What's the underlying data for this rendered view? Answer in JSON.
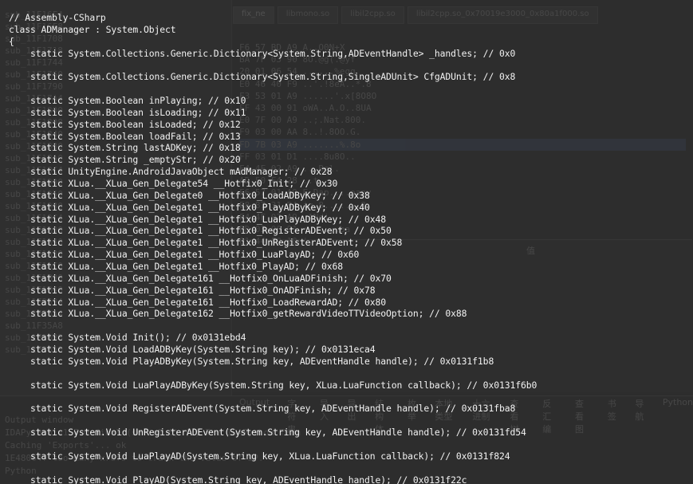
{
  "background": {
    "left_rows": [
      "sub_11F16F4",
      "sub_11F16F8",
      "sub_11F1708",
      "sub_11F1718",
      "sub_11F1744",
      "sub_11F1760",
      "sub_11F1790",
      "sub_11F17A4",
      "sub_11F1800",
      "sub_11F1808",
      "sub_11F1840",
      "sub_11F1880",
      "sub_11F18A0",
      "sub_11F18C4",
      "sub_11F1900",
      "sub_11F1950",
      "sub_11F1980",
      "sub_11F19C4",
      "sub_11F1A00",
      "sub_11F1A40",
      "sub_11F1A80",
      "sub_11F1AC0",
      "sub_11F1B00",
      "sub_11F1B40",
      "sub_11F3594",
      "sub_11F35A4",
      "sub_11F35A8",
      "sub_11F35B8",
      "sub_11F36A0"
    ],
    "tabs": [
      "fix_ne",
      "libmono.so",
      "libil2cpp.so",
      "libil2cpp.so_0x70019e3000_0x80a1f000.so"
    ],
    "hex_rows": [
      "F6 57 BD A9   A..O0N+X",
      "BA 7F 03 90   8O.@g(.@yf",
      "20 01 06 54   ......%egg",
      "E0 46 40 F9   ..'.!8eA..*.8",
      "F3 53 01 A9   ......'.x[8O8O",
      "FF 43 00 91   oWA..A.O..8UA",
      "E0 7F 00 A9   ..;.Nat.800.",
      "F9 03 00 AA   8..!.8OO.G.",
      "FD 7B 03 A9   .......%.8o",
      "FF 03 01 D1   ....8u8O..",
      "F4 4F 02 A9   ...Bgl.",
      "AD 50 F4 28   ..t.",
      "F6 57 01 A9   E.Dap....eapy",
      "E8 87 31 B4   jq.8.......8.",
      "F4 4F 02 A9   .ANdi.",
      "FD 03 00 91   :......ba",
      "01 44 F9 10   ',,"
    ],
    "panel_title": "值",
    "bottom_tabs": [
      "Output",
      "字符串",
      "导入",
      "导出",
      "结构体",
      "枚举",
      "本地类型",
      "十六进制",
      "查看树",
      "反汇编",
      "查看图",
      "书签",
      "导航",
      "Python"
    ],
    "status_rows": [
      "Output window",
      "IDAPython v1.7.0 final (serial 0) (c) The IDAPython Team",
      "Caching 'Exports'... ok",
      "1E48064: too many xrefs to track the value of SP.",
      "Python"
    ]
  },
  "code_lines": [
    "// Assembly-CSharp",
    "class ADManager : System.Object",
    "{",
    "    static System.Collections.Generic.Dictionary<System.String,ADEventHandle> _handles; // 0x0",
    "",
    "    static System.Collections.Generic.Dictionary<System.String,SingleADUnit> CfgADUnit; // 0x8",
    "",
    "    static System.Boolean inPlaying; // 0x10",
    "    static System.Boolean isLoading; // 0x11",
    "    static System.Boolean isLoaded; // 0x12",
    "    static System.Boolean loadFail; // 0x13",
    "    static System.String lastADKey; // 0x18",
    "    static System.String _emptyStr; // 0x20",
    "    static UnityEngine.AndroidJavaObject mAdManager; // 0x28",
    "    static XLua.__XLua_Gen_Delegate54 __Hotfix0_Init; // 0x30",
    "    static XLua.__XLua_Gen_Delegate0 __Hotfix0_LoadADByKey; // 0x38",
    "    static XLua.__XLua_Gen_Delegate1 __Hotfix0_PlayADByKey; // 0x40",
    "    static XLua.__XLua_Gen_Delegate1 __Hotfix0_LuaPlayADByKey; // 0x48",
    "    static XLua.__XLua_Gen_Delegate1 __Hotfix0_RegisterADEvent; // 0x50",
    "    static XLua.__XLua_Gen_Delegate1 __Hotfix0_UnRegisterADEvent; // 0x58",
    "    static XLua.__XLua_Gen_Delegate1 __Hotfix0_LuaPlayAD; // 0x60",
    "    static XLua.__XLua_Gen_Delegate1 __Hotfix0_PlayAD; // 0x68",
    "    static XLua.__XLua_Gen_Delegate161 __Hotfix0_OnLuaADFinish; // 0x70",
    "    static XLua.__XLua_Gen_Delegate161 __Hotfix0_OnADFinish; // 0x78",
    "    static XLua.__XLua_Gen_Delegate161 __Hotfix0_LoadRewardAD; // 0x80",
    "    static XLua.__XLua_Gen_Delegate162 __Hotfix0_getRewardVideoTTVideoOption; // 0x88",
    "",
    "    static System.Void Init(); // 0x0131ebd4",
    "    static System.Void LoadADByKey(System.String key); // 0x0131eca4",
    "    static System.Void PlayADByKey(System.String key, ADEventHandle handle); // 0x0131f1b8",
    "",
    "    static System.Void LuaPlayADByKey(System.String key, XLua.LuaFunction callback); // 0x0131f6b0",
    "",
    "    static System.Void RegisterADEvent(System.String key, ADEventHandle handle); // 0x0131fba8",
    "",
    "    static System.Void UnRegisterADEvent(System.String key, ADEventHandle handle); // 0x0131fd54",
    "",
    "    static System.Void LuaPlayAD(System.String key, XLua.LuaFunction callback); // 0x0131f824",
    "",
    "    static System.Void PlayAD(System.String key, ADEventHandle handle); // 0x0131f22c"
  ]
}
